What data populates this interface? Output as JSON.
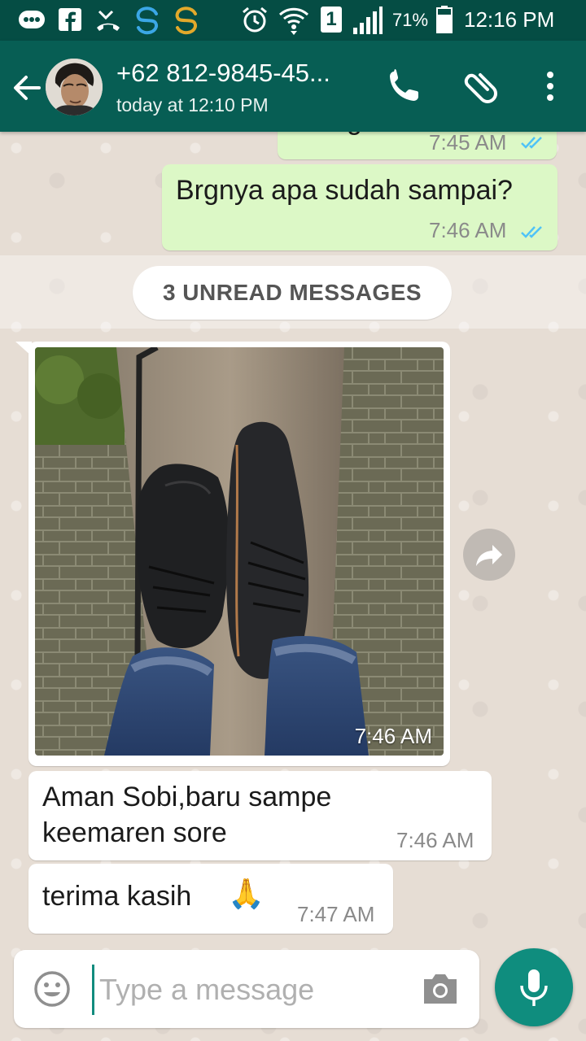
{
  "status_bar": {
    "battery": "71%",
    "time": "12:16 PM",
    "sim_slot": "1",
    "icons": [
      "bbm-icon",
      "facebook-icon",
      "missed-call-icon",
      "sync-icon",
      "sync-yellow-icon",
      "alarm-icon",
      "wifi-icon",
      "sim-icon",
      "signal-icon",
      "battery-icon"
    ]
  },
  "header": {
    "contact_name": "+62 812-9845-45...",
    "last_seen": "today at 12:10 PM",
    "icons": [
      "back-arrow-icon",
      "call-icon",
      "attach-icon",
      "more-icon"
    ]
  },
  "messages": {
    "outgoing_partial": {
      "text": "Sob gmn",
      "time": "7:45 AM"
    },
    "outgoing_1": {
      "text": "Brgnya apa sudah sampai?",
      "time": "7:46 AM"
    },
    "unread_label": "3 UNREAD MESSAGES",
    "image_time": "7:46 AM",
    "incoming_1": {
      "line1": "Aman Sobi,baru sampe",
      "line2": "keemaren sore",
      "time": "7:46 AM"
    },
    "incoming_2": {
      "text": "terima kasih",
      "emoji": "🙏",
      "time": "7:47 AM"
    }
  },
  "composer": {
    "placeholder": "Type a message",
    "icons": [
      "emoji-icon",
      "camera-icon",
      "mic-icon"
    ]
  },
  "colors": {
    "status_bar": "#054d44",
    "app_bar": "#075e54",
    "outgoing_bubble": "#dcf8c6",
    "incoming_bubble": "#ffffff",
    "chat_background": "#e6ddd4",
    "read_ticks": "#4fc3f7",
    "mic_button": "#0f8d7e"
  }
}
